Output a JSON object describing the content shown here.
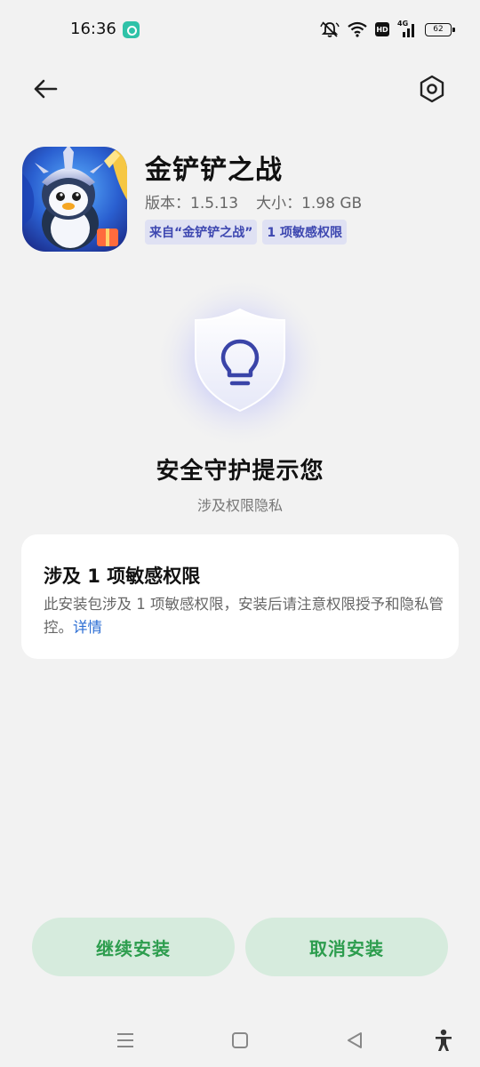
{
  "status_bar": {
    "time": "16:36",
    "battery_level": "62",
    "icons": [
      "app-notification-icon",
      "mute-icon",
      "wifi-icon",
      "hd-icon",
      "4g-signal-icon",
      "battery-icon"
    ],
    "hd_label": "HD",
    "network_label": "4G"
  },
  "top_bar": {
    "back_icon": "arrow-left-icon",
    "settings_icon": "hexagon-gear-icon"
  },
  "app": {
    "name": "金铲铲之战",
    "version": "版本：1.5.13",
    "size": "大小：1.98 GB",
    "tags": [
      "来自“金铲铲之战”",
      "1 项敏感权限"
    ]
  },
  "security": {
    "icon": "shield-lightbulb-icon",
    "title": "安全守护提示您",
    "subtitle": "涉及权限隐私"
  },
  "permission_card": {
    "title": "涉及 1 项敏感权限",
    "body": "此安装包涉及 1 项敏感权限，安装后请注意权限授予和隐私管控。",
    "details_link": "详情"
  },
  "actions": {
    "continue_label": "继续安装",
    "cancel_label": "取消安装"
  },
  "nav_bar": {
    "icons": [
      "menu-icon",
      "home-icon",
      "back-triangle-icon",
      "accessibility-icon"
    ]
  },
  "colors": {
    "background": "#f2f2f2",
    "tag_bg": "#dfe1f3",
    "tag_text": "#3d47b0",
    "button_bg": "#d6ebdd",
    "button_text": "#2d9d4e",
    "link": "#2e6fd4",
    "shield_accent": "#3a44a8"
  }
}
